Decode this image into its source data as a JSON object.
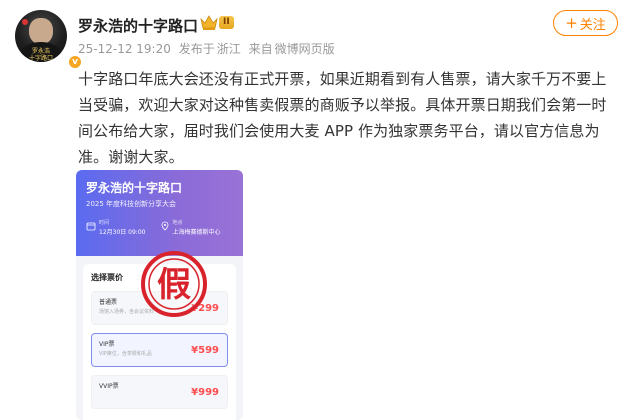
{
  "post": {
    "author": {
      "name": "罗永浩的十字路口",
      "level": "II",
      "avatar_tag": "罗永浩\n十字路口"
    },
    "meta": {
      "time": "25-12-12 19:20",
      "location_prefix": "发布于",
      "location": "浙江",
      "source_prefix": "来自",
      "source": "微博网页版"
    },
    "follow_label": "关注",
    "text": "十字路口年底大会还没有正式开票，如果近期看到有人售票，请大家千万不要上当受骗，欢迎大家对这种售卖假票的商贩予以举报。具体开票日期我们会第一时间公布给大家，届时我们会使用大麦 APP 作为独家票务平台，请以官方信息为准。谢谢大家。"
  },
  "image": {
    "event_title": "罗永浩的十字路口",
    "event_subtitle": "2025 年度科技创新分享大会",
    "time_label": "时间",
    "time_value": "12月30日 09:00",
    "venue_label": "地点",
    "venue_value": "上海梅赛德斯中心",
    "panel_title": "选择票价",
    "stamp_text": "假",
    "tickets": [
      {
        "name": "普通票",
        "desc": "场馆入场券，含会议资料",
        "price": "¥299"
      },
      {
        "name": "VIP票",
        "desc": "VIP席位，含茶歇和礼品",
        "price": "¥599"
      },
      {
        "name": "VVIP票",
        "desc": "",
        "price": "¥999"
      }
    ]
  },
  "colors": {
    "accent": "#ff8200",
    "price": "#ff4d4f",
    "stamp": "#d9232c"
  }
}
